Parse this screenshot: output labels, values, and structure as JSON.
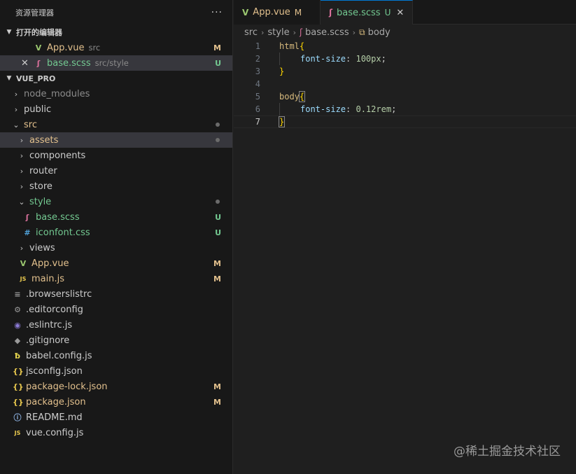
{
  "explorer": {
    "title": "资源管理器",
    "more": "···",
    "open_editors_title": "打开的编辑器",
    "open_editors": [
      {
        "name": "App.vue",
        "desc": "src",
        "status": "M",
        "icon": "vue-icon"
      },
      {
        "name": "base.scss",
        "desc": "src/style",
        "status": "U",
        "icon": "sass-icon",
        "close": "✕"
      }
    ],
    "project_title": "VUE_PRO",
    "tree": [
      {
        "name": "node_modules",
        "type": "folder",
        "open": false,
        "depth": 0
      },
      {
        "name": "public",
        "type": "folder",
        "open": false,
        "depth": 0
      },
      {
        "name": "src",
        "type": "folder",
        "open": true,
        "depth": 0
      },
      {
        "name": "assets",
        "type": "folder",
        "open": false,
        "depth": 1
      },
      {
        "name": "components",
        "type": "folder",
        "open": false,
        "depth": 1
      },
      {
        "name": "router",
        "type": "folder",
        "open": false,
        "depth": 1
      },
      {
        "name": "store",
        "type": "folder",
        "open": false,
        "depth": 1
      },
      {
        "name": "style",
        "type": "folder",
        "open": true,
        "depth": 1
      },
      {
        "name": "base.scss",
        "type": "file",
        "status": "U",
        "depth": 2,
        "icon": "sass-icon"
      },
      {
        "name": "iconfont.css",
        "type": "file",
        "status": "U",
        "depth": 2,
        "icon": "css-icon"
      },
      {
        "name": "views",
        "type": "folder",
        "open": false,
        "depth": 1
      },
      {
        "name": "App.vue",
        "type": "file",
        "status": "M",
        "depth": 1,
        "icon": "vue-icon"
      },
      {
        "name": "main.js",
        "type": "file",
        "status": "M",
        "depth": 1,
        "icon": "js-icon"
      },
      {
        "name": ".browserslistrc",
        "type": "file",
        "depth": 0,
        "icon": "lines-icon"
      },
      {
        "name": ".editorconfig",
        "type": "file",
        "depth": 0,
        "icon": "gear-icon"
      },
      {
        "name": ".eslintrc.js",
        "type": "file",
        "depth": 0,
        "icon": "eslint-icon"
      },
      {
        "name": ".gitignore",
        "type": "file",
        "depth": 0,
        "icon": "git-icon"
      },
      {
        "name": "babel.config.js",
        "type": "file",
        "depth": 0,
        "icon": "babel-icon"
      },
      {
        "name": "jsconfig.json",
        "type": "file",
        "depth": 0,
        "icon": "json-icon"
      },
      {
        "name": "package-lock.json",
        "type": "file",
        "status": "M",
        "depth": 0,
        "icon": "json-icon"
      },
      {
        "name": "package.json",
        "type": "file",
        "status": "M",
        "depth": 0,
        "icon": "json-icon"
      },
      {
        "name": "README.md",
        "type": "file",
        "depth": 0,
        "icon": "info-icon"
      },
      {
        "name": "vue.config.js",
        "type": "file",
        "depth": 0,
        "icon": "js-icon"
      }
    ]
  },
  "tabs": [
    {
      "name": "App.vue",
      "status": "M",
      "active": false
    },
    {
      "name": "base.scss",
      "status": "U",
      "active": true,
      "close": "✕"
    }
  ],
  "breadcrumb": {
    "parts": [
      "src",
      "style",
      "base.scss",
      "body"
    ]
  },
  "code": {
    "line_numbers": [
      "1",
      "2",
      "3",
      "4",
      "5",
      "6",
      "7"
    ],
    "lines": {
      "l1_sel": "html",
      "l1_brace": "{",
      "l2_prop": "font-size",
      "l2_colon": ": ",
      "l2_val": "100px",
      "l2_semi": ";",
      "l3_brace": "}",
      "l5_sel": "body",
      "l5_brace": "{",
      "l6_prop": "font-size",
      "l6_colon": ": ",
      "l6_val": "0.12rem",
      "l6_semi": ";",
      "l7_brace": "}"
    }
  },
  "watermark": "@稀土掘金技术社区"
}
